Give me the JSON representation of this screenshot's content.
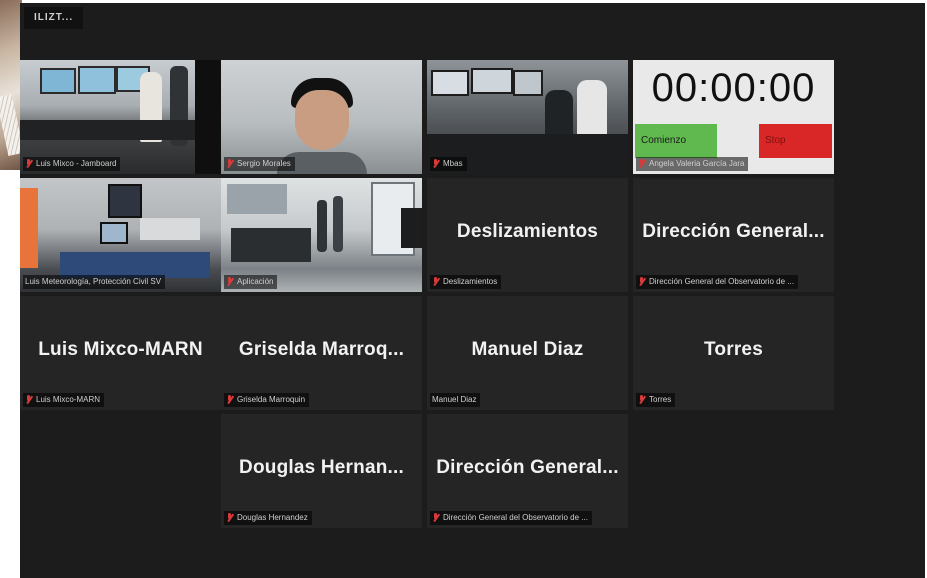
{
  "window": {
    "title": "ILIZT..."
  },
  "tiles": [
    {
      "caption": "Luis Mixco - Jamboard",
      "type": "video"
    },
    {
      "caption": "Sergio Morales",
      "type": "video"
    },
    {
      "caption": "Mbas",
      "type": "video"
    },
    {
      "caption": "Angela Valeria García Jara",
      "type": "timer",
      "timer": {
        "display": "00:00:00",
        "start_label": "Comienzo",
        "stop_label": "Stop"
      }
    },
    {
      "caption": "Luis Meteorología, Protección Civil SV",
      "type": "video",
      "active": true
    },
    {
      "caption": "Aplicación",
      "type": "video"
    },
    {
      "name": "Deslizamientos",
      "caption": "Deslizamientos",
      "type": "name"
    },
    {
      "name": "Dirección General...",
      "caption": "Dirección General del Observatorio de ...",
      "type": "name"
    },
    {
      "name": "Luis Mixco-MARN",
      "caption": "Luis Mixco-MARN",
      "type": "name"
    },
    {
      "name": "Griselda Marroq...",
      "caption": "Griselda Marroquin",
      "type": "name"
    },
    {
      "name": "Manuel Diaz",
      "caption": "Manuel Diaz",
      "type": "name",
      "muted": false
    },
    {
      "name": "Torres",
      "caption": "Torres",
      "type": "name"
    },
    {
      "name": "Douglas Hernan...",
      "caption": "Douglas Hernandez",
      "type": "name"
    },
    {
      "name": "Dirección General...",
      "caption": "Dirección General del Observatorio de ...",
      "type": "name"
    }
  ],
  "colors": {
    "background": "#1c1c1c",
    "tile": "#252525",
    "active_border": "#b8d35a",
    "muted_icon": "#d83b3b",
    "start_button": "#5fb94f",
    "stop_button": "#d92727"
  },
  "icons": {
    "muted": "mic-off-icon"
  }
}
